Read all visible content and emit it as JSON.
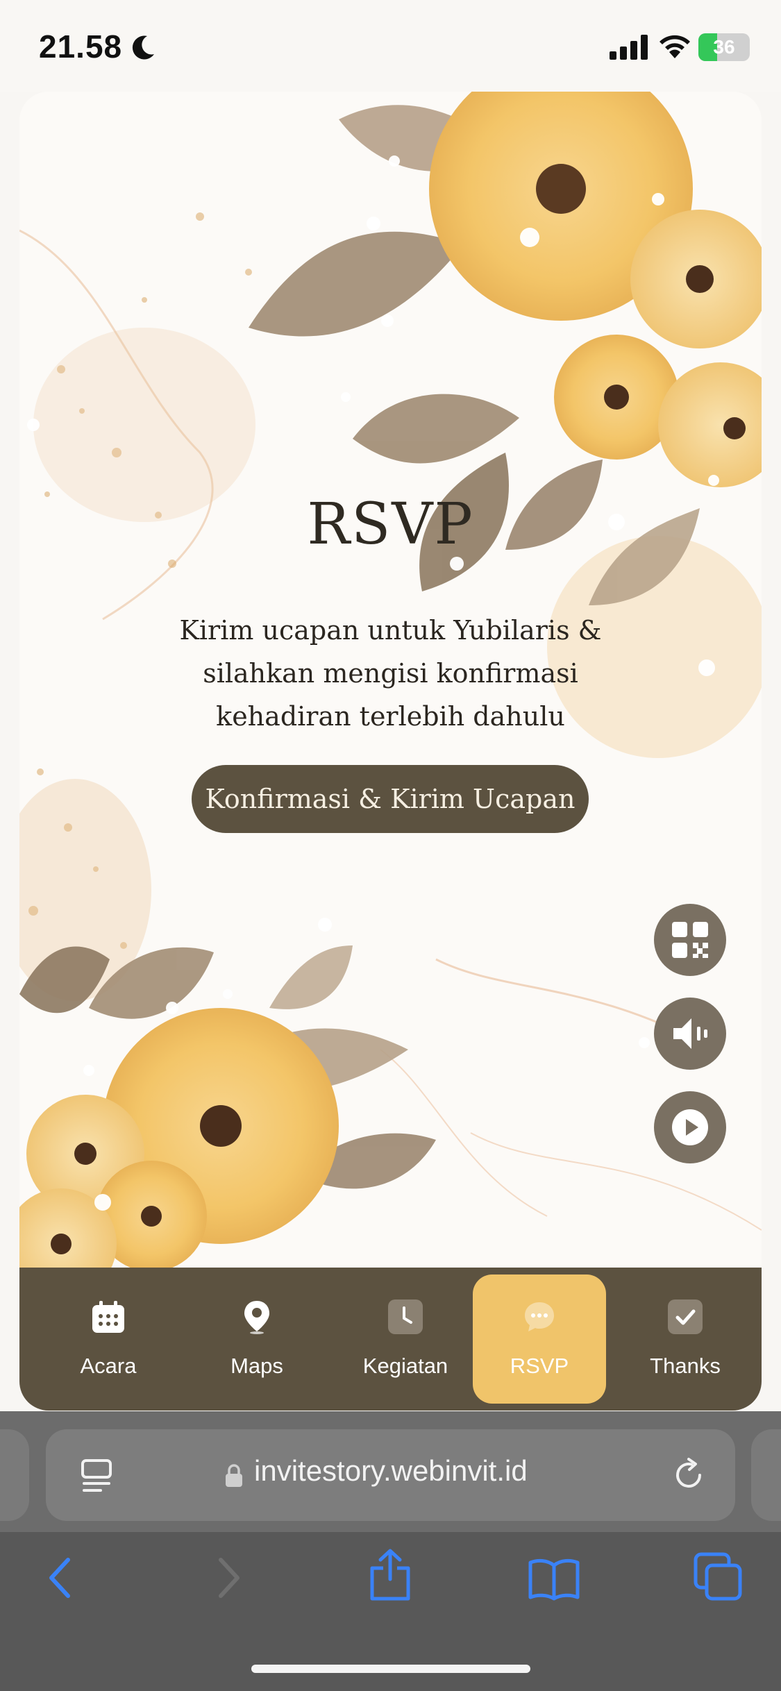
{
  "status_bar": {
    "time": "21.58",
    "battery_percent": "36",
    "battery_level": 0.36,
    "focus_mode_icon": "moon-icon"
  },
  "rsvp": {
    "title": "RSVP",
    "lines": [
      "Kirim ucapan untuk Yubilaris &",
      "silahkan mengisi konfirmasi",
      "kehadiran terlebih dahulu"
    ],
    "button_label": "Konfirmasi & Kirim Ucapan"
  },
  "floating_buttons": [
    {
      "icon": "qr-code-icon"
    },
    {
      "icon": "speaker-icon"
    },
    {
      "icon": "play-icon"
    }
  ],
  "tabs": [
    {
      "label": "Acara",
      "icon": "calendar-icon",
      "active": false
    },
    {
      "label": "Maps",
      "icon": "map-pin-icon",
      "active": false
    },
    {
      "label": "Kegiatan",
      "icon": "clock-icon",
      "active": false
    },
    {
      "label": "RSVP",
      "icon": "chat-bubble-icon",
      "active": true
    },
    {
      "label": "Thanks",
      "icon": "checkmark-icon",
      "active": false
    }
  ],
  "browser": {
    "url": "invitestory.webinvit.id"
  },
  "colors": {
    "accent": "#5c5240",
    "active_tab": "#f0c46a",
    "ios_link": "#3a82f7",
    "battery_green": "#34c759"
  }
}
